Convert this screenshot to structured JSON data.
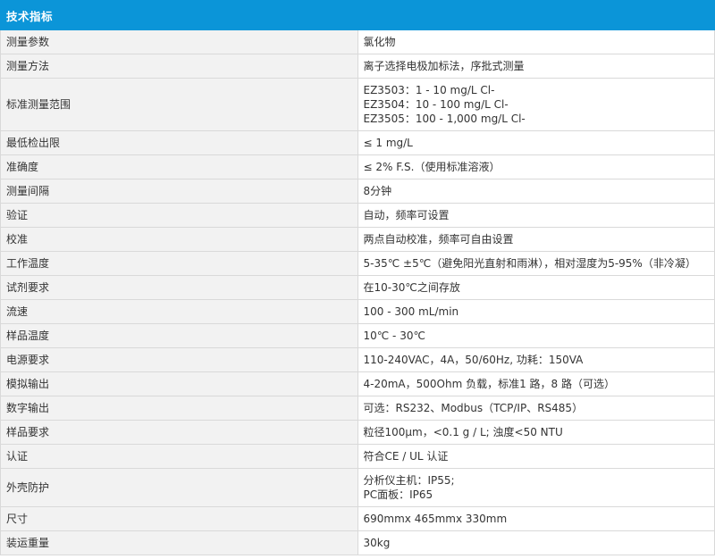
{
  "table": {
    "header": "技术指标",
    "rows": [
      {
        "label": "测量参数",
        "lines": [
          "氯化物"
        ]
      },
      {
        "label": "测量方法",
        "lines": [
          "离子选择电极加标法，序批式测量"
        ]
      },
      {
        "label": "标准测量范围",
        "lines": [
          "EZ3503：1 - 10 mg/L Cl-",
          "EZ3504：10 - 100 mg/L Cl-",
          "EZ3505：100 - 1,000 mg/L Cl-"
        ]
      },
      {
        "label": "最低检出限",
        "lines": [
          "≤ 1 mg/L"
        ]
      },
      {
        "label": "准确度",
        "lines": [
          "≤ 2% F.S.（使用标准溶液）"
        ]
      },
      {
        "label": "测量间隔",
        "lines": [
          "8分钟"
        ]
      },
      {
        "label": "验证",
        "lines": [
          "自动，频率可设置"
        ]
      },
      {
        "label": "校准",
        "lines": [
          "两点自动校准，频率可自由设置"
        ]
      },
      {
        "label": "工作温度",
        "lines": [
          "5-35℃ ±5℃（避免阳光直射和雨淋），相对湿度为5-95%（非冷凝）"
        ]
      },
      {
        "label": "试剂要求",
        "lines": [
          "在10-30℃之间存放"
        ]
      },
      {
        "label": "流速",
        "lines": [
          "100 - 300 mL/min"
        ]
      },
      {
        "label": "样品温度",
        "lines": [
          "10℃ - 30℃"
        ]
      },
      {
        "label": "电源要求",
        "lines": [
          "110-240VAC，4A，50/60Hz, 功耗：150VA"
        ]
      },
      {
        "label": "模拟输出",
        "lines": [
          "4-20mA，500Ohm 负载，标准1 路，8 路（可选）"
        ]
      },
      {
        "label": "数字输出",
        "lines": [
          "可选：RS232、Modbus（TCP/IP、RS485）"
        ]
      },
      {
        "label": "样品要求",
        "lines": [
          "粒径100µm，<0.1 g / L; 浊度<50 NTU"
        ]
      },
      {
        "label": "认证",
        "lines": [
          "符合CE / UL 认证"
        ]
      },
      {
        "label": "外壳防护",
        "lines": [
          "分析仪主机：IP55;",
          "PC面板：IP65"
        ]
      },
      {
        "label": "尺寸",
        "lines": [
          "690mmx 465mmx 330mm"
        ]
      },
      {
        "label": "装运重量",
        "lines": [
          "30kg"
        ]
      }
    ]
  }
}
